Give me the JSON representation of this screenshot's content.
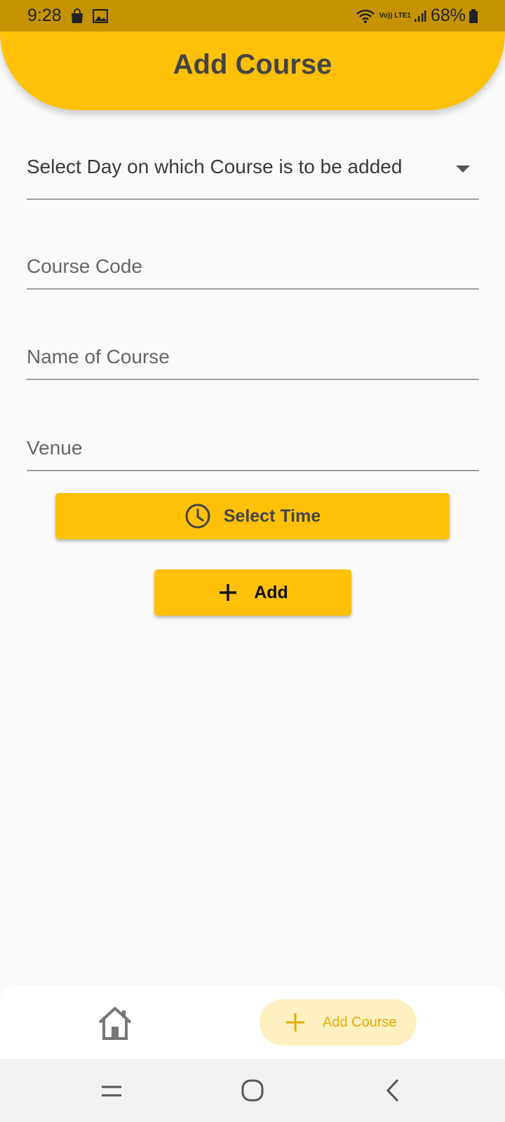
{
  "status_bar": {
    "time": "9:28",
    "network": "Vo)) LTE1",
    "battery_percent": "68%",
    "icons": [
      "shopping-bag-icon",
      "image-icon",
      "wifi-icon",
      "signal-icon",
      "battery-icon"
    ]
  },
  "header": {
    "title": "Add Course"
  },
  "form": {
    "day_dropdown": {
      "label": "Select Day on which Course is to be added"
    },
    "course_code": {
      "placeholder": "Course Code",
      "value": ""
    },
    "course_name": {
      "placeholder": "Name of Course",
      "value": ""
    },
    "venue": {
      "placeholder": "Venue",
      "value": ""
    },
    "select_time_label": "Select Time",
    "add_label": "Add"
  },
  "bottom_nav": {
    "items": [
      {
        "icon": "home-icon",
        "label": ""
      },
      {
        "icon": "plus-icon",
        "label": "Add Course",
        "active": true
      }
    ]
  },
  "colors": {
    "accent": "#ffc107",
    "status_bar": "#c59300",
    "active_pill": "#fff0c2",
    "active_text": "#e6ad00",
    "background": "#fafafa"
  }
}
